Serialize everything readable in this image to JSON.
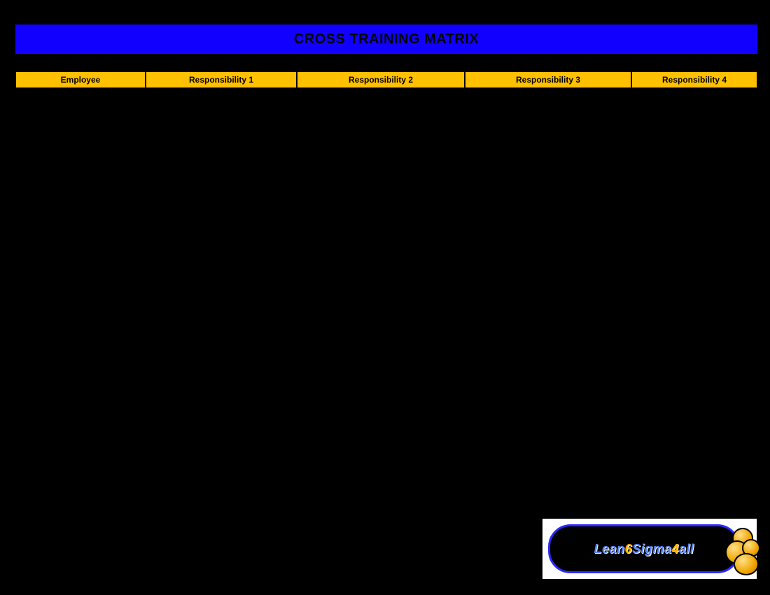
{
  "title": "CROSS TRAINING MATRIX",
  "columns": [
    "Employee",
    "Responsibility 1",
    "Responsibility 2",
    "Responsibility 3",
    "Responsibility 4"
  ],
  "logo": {
    "segments": [
      {
        "text": "Lean",
        "cls": "lt-blue"
      },
      {
        "text": "6",
        "cls": "lt-gold"
      },
      {
        "text": "Sigma",
        "cls": "lt-blue"
      },
      {
        "text": "4",
        "cls": "lt-gold"
      },
      {
        "text": "all",
        "cls": "lt-blue"
      }
    ]
  },
  "colors": {
    "title_bg": "#1200ff",
    "header_bg": "#ffc000",
    "page_bg": "#000000"
  }
}
